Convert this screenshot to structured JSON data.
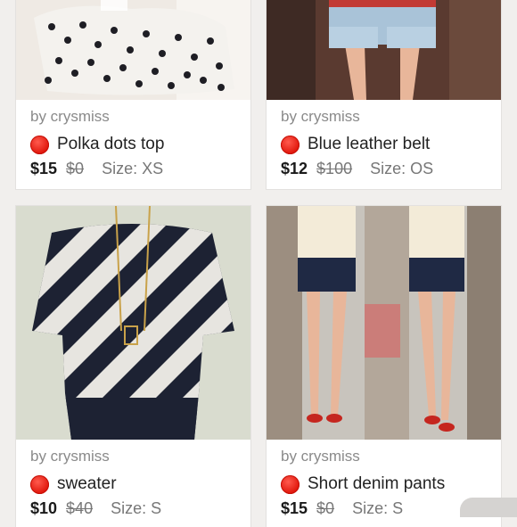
{
  "listings": [
    {
      "seller": "by crysmiss",
      "title": "Polka dots top",
      "price": "$15",
      "original_price": "$0",
      "size": "Size: XS"
    },
    {
      "seller": "by crysmiss",
      "title": "Blue leather belt",
      "price": "$12",
      "original_price": "$100",
      "size": "Size: OS"
    },
    {
      "seller": "by crysmiss",
      "title": "sweater",
      "price": "$10",
      "original_price": "$40",
      "size": "Size: S"
    },
    {
      "seller": "by crysmiss",
      "title": "Short denim pants",
      "price": "$15",
      "original_price": "$0",
      "size": "Size: S"
    }
  ],
  "icons": {
    "status": "red-dot-icon"
  },
  "colors": {
    "status_dot": "#e0160b",
    "background": "#f1efed",
    "card": "#ffffff"
  }
}
